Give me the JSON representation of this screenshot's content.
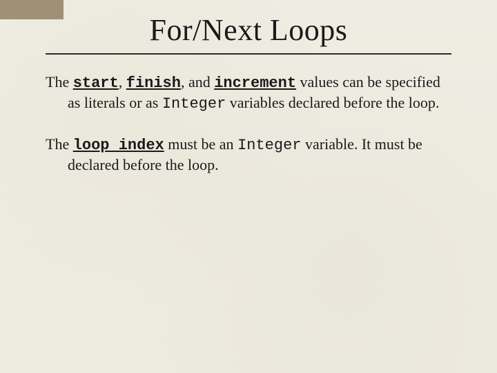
{
  "title": "For/Next Loops",
  "para1": {
    "lead": "The ",
    "kw1": "start",
    "sep1": ", ",
    "kw2": "finish",
    "sep2": ", and ",
    "kw3": "increment",
    "mid": " values can be specified as literals or as ",
    "code": "Integer",
    "tail": " variables declared before the loop."
  },
  "para2": {
    "lead": "The ",
    "kw": "loop index",
    "mid": " must be an ",
    "code": "Integer",
    "tail": " variable. It must be declared before the loop."
  }
}
